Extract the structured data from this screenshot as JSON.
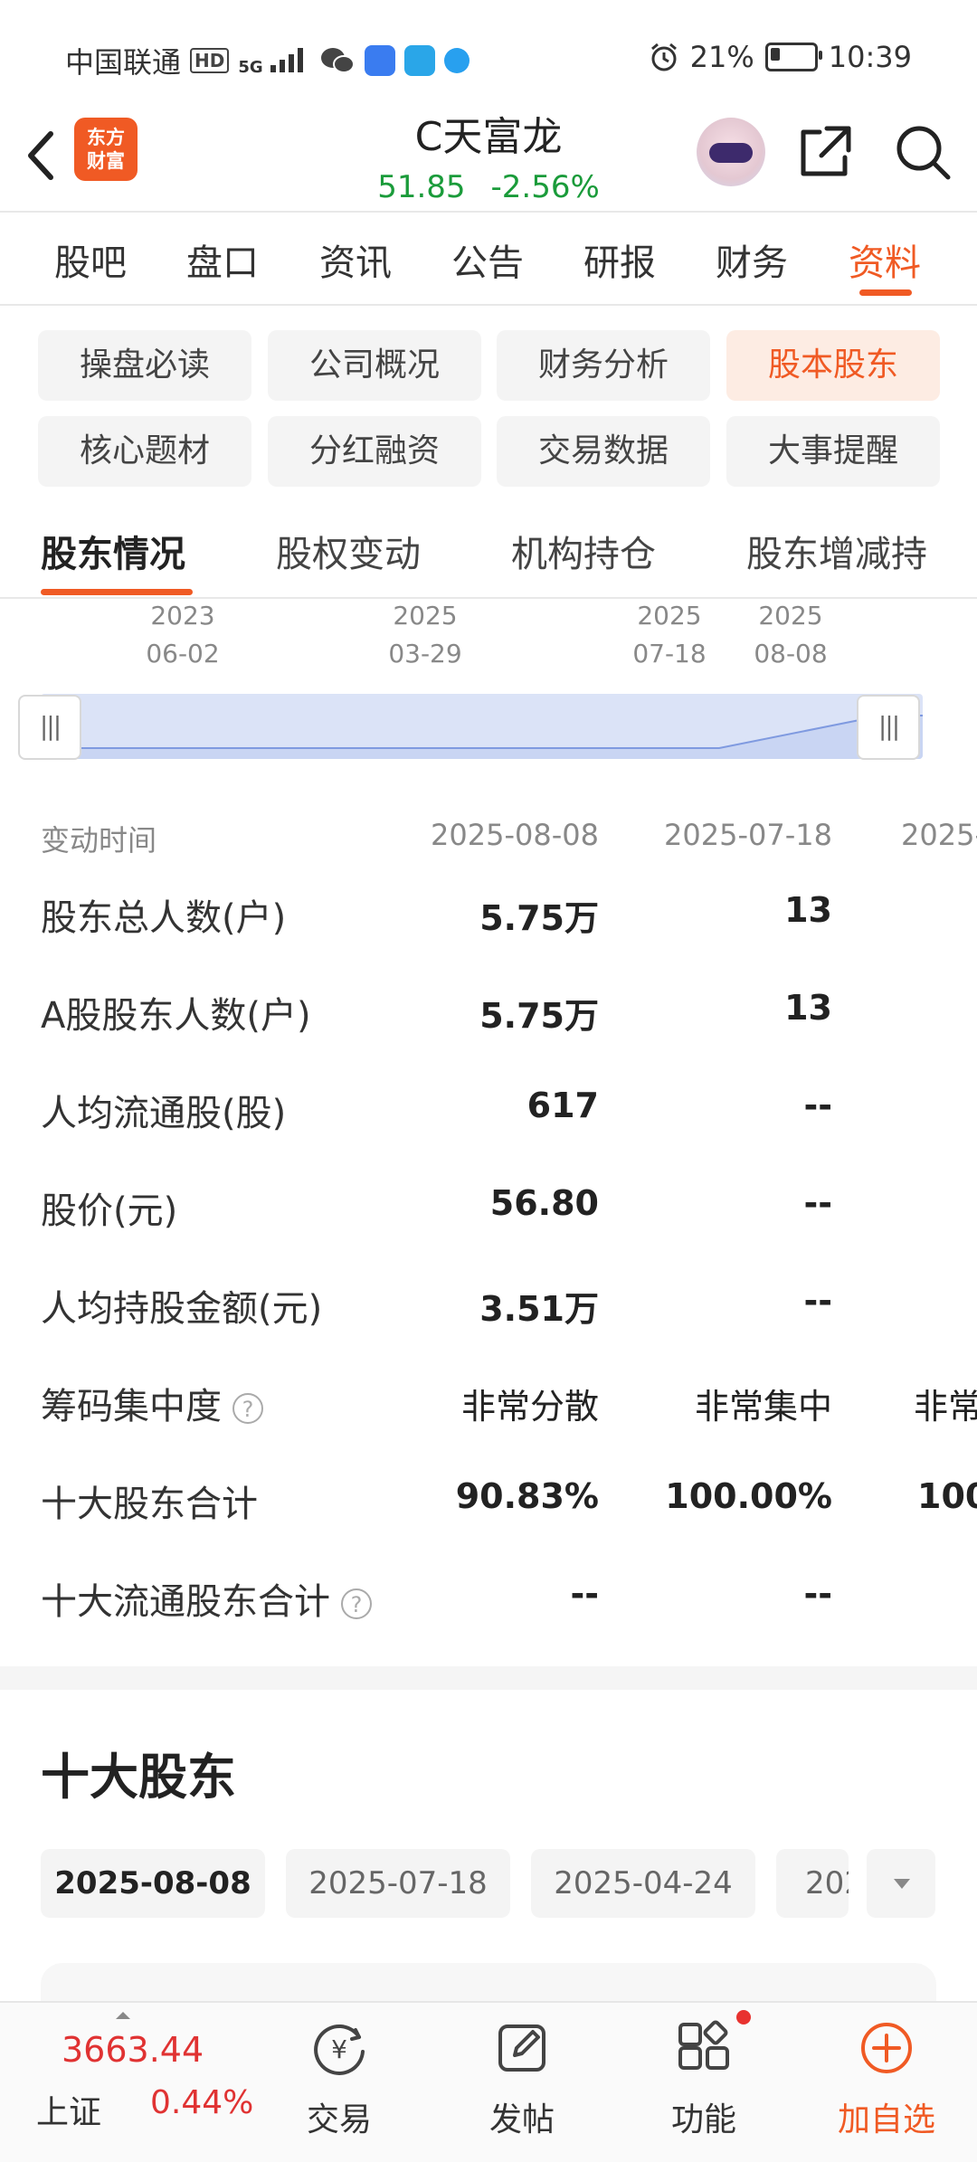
{
  "status_bar": {
    "carrier": "中国联通",
    "hd": "HD",
    "signal": "5G",
    "battery": "21%",
    "battery_level": 0.21,
    "time": "10:39"
  },
  "header": {
    "logo": [
      "东方",
      "财富"
    ],
    "stock_name": "C天富龙",
    "price": "51.85",
    "change_pct": "-2.56%",
    "price_color": "#1a9b3a"
  },
  "tabs": [
    "股吧",
    "盘口",
    "资讯",
    "公告",
    "研报",
    "财务",
    "资料"
  ],
  "active_tab": "资料",
  "chips": [
    "操盘必读",
    "公司概况",
    "财务分析",
    "股本股东",
    "核心题材",
    "分红融资",
    "交易数据",
    "大事提醒"
  ],
  "active_chip": "股本股东",
  "subtabs": [
    "股东情况",
    "股权变动",
    "机构持仓",
    "股东增减持"
  ],
  "active_subtab": "股东情况",
  "timeline": {
    "dates": [
      {
        "year": "2023",
        "day": "06-02"
      },
      {
        "year": "2025",
        "day": "03-29"
      },
      {
        "year": "2025",
        "day": "07-18"
      },
      {
        "year": "2025",
        "day": "08-08"
      }
    ],
    "handle_glyph": "|||"
  },
  "table": {
    "header_label": "变动时间",
    "columns": [
      "2025-08-08",
      "2025-07-18",
      "2025-"
    ],
    "rows": [
      {
        "label": "股东总人数(户)",
        "values": [
          "5.75万",
          "13",
          ""
        ]
      },
      {
        "label": "A股股东人数(户)",
        "values": [
          "5.75万",
          "13",
          ""
        ]
      },
      {
        "label": "人均流通股(股)",
        "values": [
          "617",
          "--",
          ""
        ]
      },
      {
        "label": "股价(元)",
        "values": [
          "56.80",
          "--",
          ""
        ]
      },
      {
        "label": "人均持股金额(元)",
        "values": [
          "3.51万",
          "--",
          ""
        ]
      },
      {
        "label": "筹码集中度",
        "values": [
          "非常分散",
          "非常集中",
          "非常"
        ],
        "help": "?"
      },
      {
        "label": "十大股东合计",
        "values": [
          "90.83%",
          "100.00%",
          "100"
        ]
      },
      {
        "label": "十大流通股东合计",
        "values": [
          "--",
          "--",
          ""
        ],
        "help": "?"
      }
    ]
  },
  "top10": {
    "title": "十大股东",
    "dates": [
      "2025-08-08",
      "2025-07-18",
      "2025-04-24",
      "202"
    ],
    "active_date": "2025-08-08"
  },
  "bottom_nav": {
    "index_value": "3663.44",
    "index_name": "上证",
    "index_change": "0.44%",
    "items": [
      "交易",
      "发帖",
      "功能",
      "加自选"
    ],
    "trade_glyph": "¥"
  }
}
